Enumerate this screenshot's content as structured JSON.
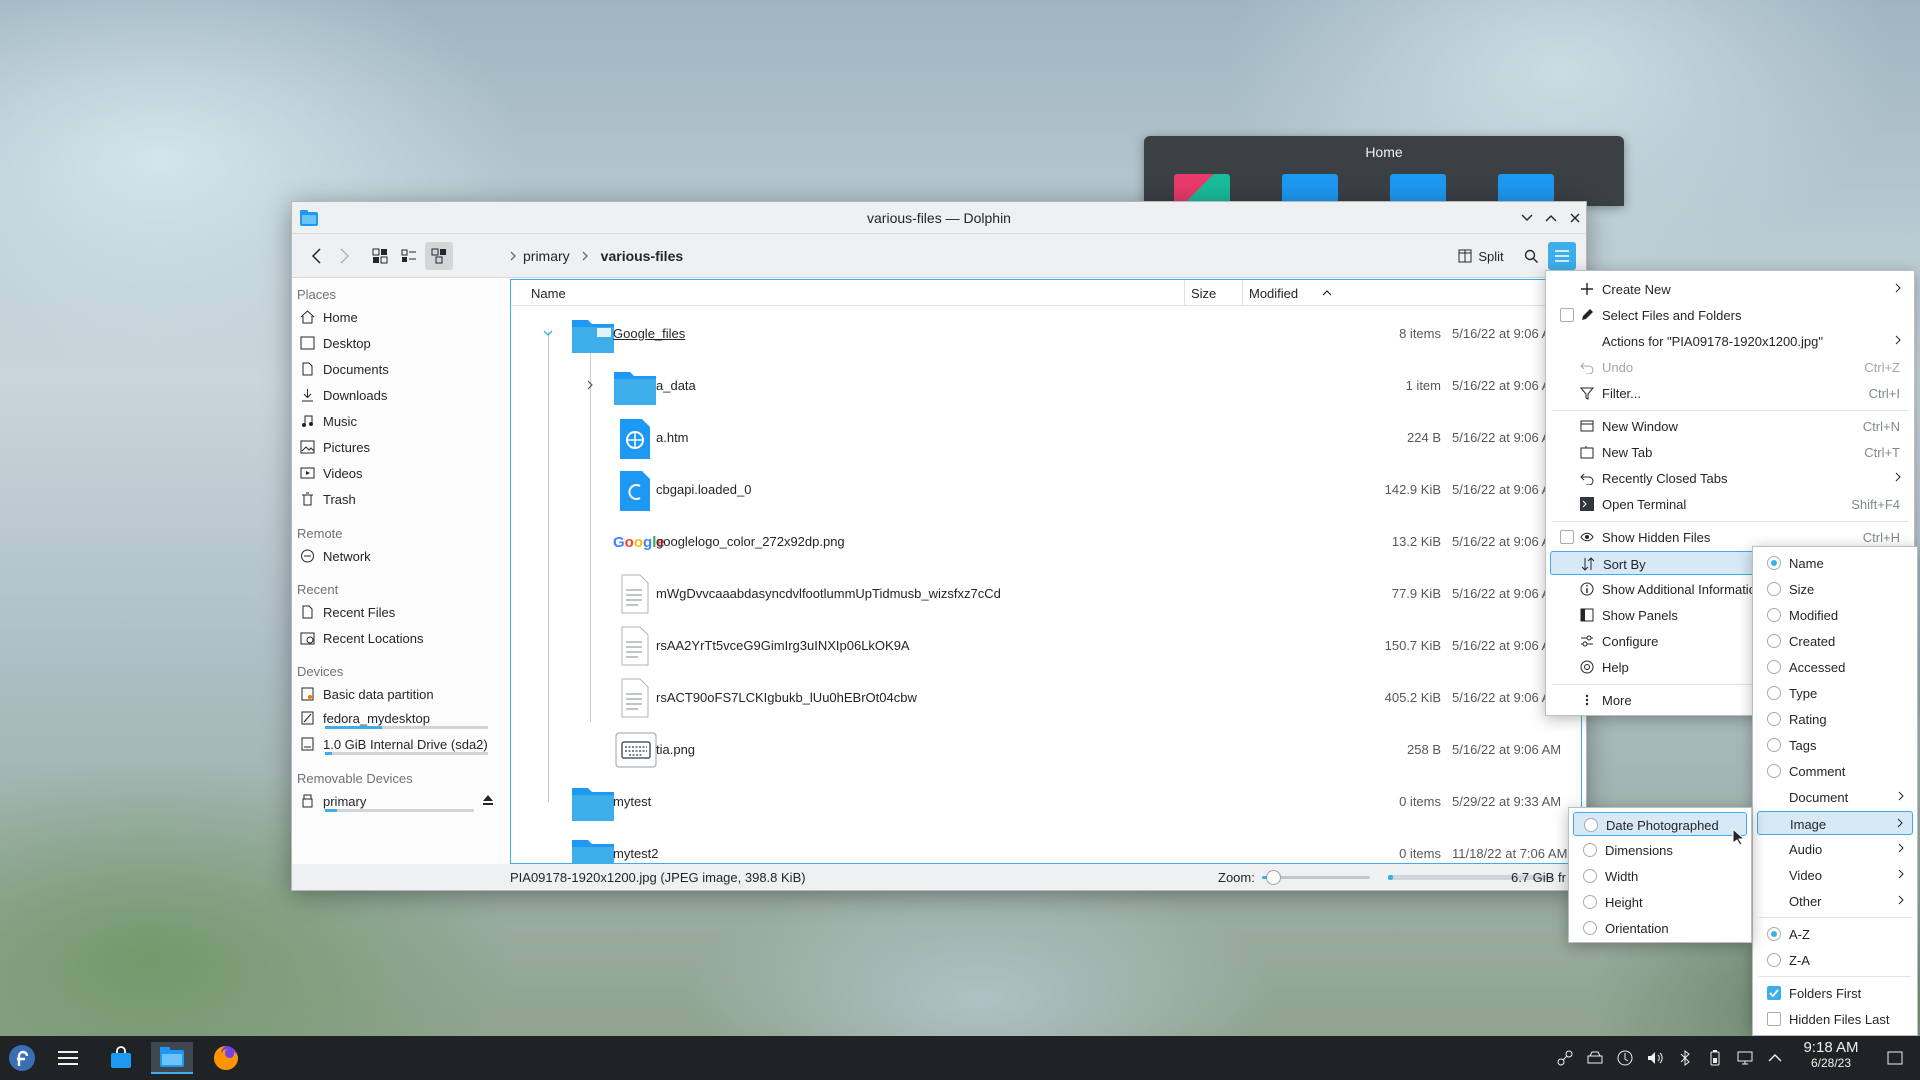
{
  "home_preview": {
    "title": "Home"
  },
  "window": {
    "title": "various-files — Dolphin",
    "breadcrumb": [
      "primary",
      "various-files"
    ],
    "split_label": "Split",
    "sidebar": {
      "places_header": "Places",
      "places": [
        "Home",
        "Desktop",
        "Documents",
        "Downloads",
        "Music",
        "Pictures",
        "Videos",
        "Trash"
      ],
      "remote_header": "Remote",
      "remote": [
        "Network"
      ],
      "recent_header": "Recent",
      "recent": [
        "Recent Files",
        "Recent Locations"
      ],
      "devices_header": "Devices",
      "devices": [
        "Basic data partition",
        "fedora_mydesktop",
        "1.0 GiB Internal Drive (sda2)"
      ],
      "removable_header": "Removable Devices",
      "removable": [
        "primary"
      ],
      "capacity": {
        "fedora_mydesktop": 0.35,
        "internal_drive": 0.04,
        "primary": 0.08
      }
    },
    "columns": {
      "name": "Name",
      "size": "Size",
      "modified": "Modified"
    },
    "rows": [
      {
        "name": "Google_files",
        "size": "8 items",
        "modified": "5/16/22 at 9:06 AM",
        "icon": "folder-icon",
        "level": 0
      },
      {
        "name": "a_data",
        "size": "1 item",
        "modified": "5/16/22 at 9:06 AM",
        "icon": "folder-icon",
        "level": 1
      },
      {
        "name": "a.htm",
        "size": "224 B",
        "modified": "5/16/22 at 9:06 AM",
        "icon": "html-file-icon",
        "level": 1
      },
      {
        "name": "cbgapi.loaded_0",
        "size": "142.9 KiB",
        "modified": "5/16/22 at 9:06 AM",
        "icon": "c-source-file-icon",
        "level": 1
      },
      {
        "name": "googlelogo_color_272x92dp.png",
        "size": "13.2 KiB",
        "modified": "5/16/22 at 9:06 AM",
        "icon": "google-logo-thumbnail",
        "level": 1
      },
      {
        "name": "mWgDvvcaaabdasyncdvlfootlummUpTidmusb_wizsfxz7cCd",
        "size": "77.9 KiB",
        "modified": "5/16/22 at 9:06 AM",
        "icon": "text-file-icon",
        "level": 1
      },
      {
        "name": "rsAA2YrTt5vceG9GimIrg3uINXIp06LkOK9A",
        "size": "150.7 KiB",
        "modified": "5/16/22 at 9:06 AM",
        "icon": "text-file-icon",
        "level": 1
      },
      {
        "name": "rsACT90oFS7LCKIgbukb_lUu0hEBrOt04cbw",
        "size": "405.2 KiB",
        "modified": "5/16/22 at 9:06 AM",
        "icon": "text-file-icon",
        "level": 1
      },
      {
        "name": "tia.png",
        "size": "258 B",
        "modified": "5/16/22 at 9:06 AM",
        "icon": "keyboard-image-thumbnail",
        "level": 1
      },
      {
        "name": "mytest",
        "size": "0 items",
        "modified": "5/29/22 at 9:33 AM",
        "icon": "folder-icon",
        "level": 0
      },
      {
        "name": "mytest2",
        "size": "0 items",
        "modified": "11/18/22 at 7:06 AM",
        "icon": "folder-icon",
        "level": 0
      }
    ],
    "status": {
      "text": "PIA09178-1920x1200.jpg (JPEG image, 398.8 KiB)",
      "zoom_label": "Zoom:",
      "zoom_value": 0.1,
      "free_space": "6.7 GiB fr",
      "free_fraction": 0.03
    }
  },
  "main_menu": {
    "items": [
      {
        "label": "Create New",
        "icon": "plus-icon",
        "submenu": true
      },
      {
        "label": "Select Files and Folders",
        "icon": "select-icon",
        "check": false
      },
      {
        "label": "Actions for \"PIA09178-1920x1200.jpg\"",
        "submenu": true
      },
      {
        "label": "Undo",
        "icon": "undo-icon",
        "shortcut": "Ctrl+Z",
        "disabled": true
      },
      {
        "label": "Filter...",
        "icon": "filter-icon",
        "shortcut": "Ctrl+I"
      },
      {
        "label": "New Window",
        "icon": "new-window-icon",
        "shortcut": "Ctrl+N"
      },
      {
        "label": "New Tab",
        "icon": "new-tab-icon",
        "shortcut": "Ctrl+T"
      },
      {
        "label": "Recently Closed Tabs",
        "icon": "history-icon",
        "submenu": true
      },
      {
        "label": "Open Terminal",
        "icon": "terminal-icon",
        "shortcut": "Shift+F4"
      },
      {
        "label": "Show Hidden Files",
        "icon": "eye-icon",
        "shortcut": "Ctrl+H",
        "check": false
      },
      {
        "label": "Sort By",
        "icon": "sort-icon",
        "submenu": true,
        "highlighted": true
      },
      {
        "label": "Show Additional Information",
        "icon": "info-icon",
        "submenu": true
      },
      {
        "label": "Show Panels",
        "icon": "panels-icon",
        "submenu": true
      },
      {
        "label": "Configure",
        "icon": "configure-icon",
        "submenu": true
      },
      {
        "label": "Help",
        "icon": "help-icon",
        "submenu": true
      },
      {
        "label": "More",
        "icon": "more-icon",
        "submenu": true
      }
    ]
  },
  "sort_menu": {
    "items": [
      "Name",
      "Size",
      "Modified",
      "Created",
      "Accessed",
      "Type",
      "Rating",
      "Tags",
      "Comment",
      "Document",
      "Image",
      "Audio",
      "Video",
      "Other"
    ],
    "selected": "Name",
    "order": [
      "A-Z",
      "Z-A"
    ],
    "order_selected": "A-Z",
    "folders_first": "Folders First",
    "hidden_last": "Hidden Files Last"
  },
  "image_menu": {
    "items": [
      "Date Photographed",
      "Dimensions",
      "Width",
      "Height",
      "Orientation"
    ]
  },
  "taskbar": {
    "time": "9:18 AM",
    "date": "6/28/23"
  },
  "colors": {
    "accent": "#3daee9",
    "folder": "#1d99f3",
    "panel": "#1f2326"
  }
}
